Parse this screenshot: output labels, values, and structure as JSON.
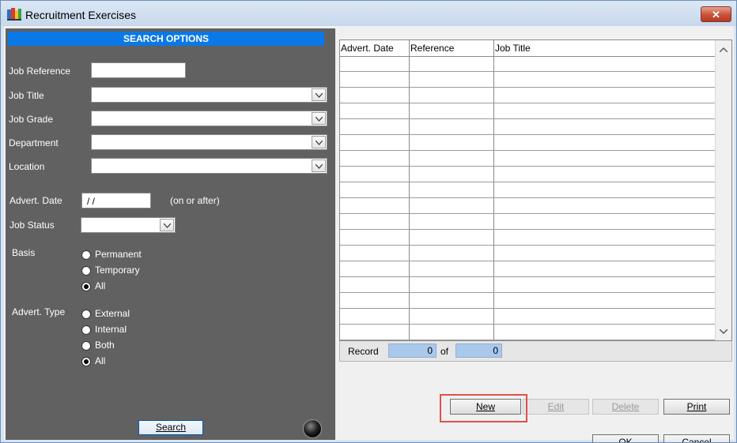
{
  "window": {
    "title": "Recruitment Exercises",
    "close_label": "✕"
  },
  "search": {
    "header": "SEARCH OPTIONS",
    "job_reference_label": "Job Reference",
    "job_reference_value": "",
    "job_title_label": "Job Title",
    "job_title_value": "",
    "job_grade_label": "Job Grade",
    "job_grade_value": "",
    "department_label": "Department",
    "department_value": "",
    "location_label": "Location",
    "location_value": "",
    "advert_date_label": "Advert. Date",
    "advert_date_value": " /  /",
    "advert_date_hint": "(on or after)",
    "job_status_label": "Job Status",
    "job_status_value": "",
    "basis_label": "Basis",
    "basis_options": [
      "Permanent",
      "Temporary",
      "All"
    ],
    "basis_selected": "All",
    "advert_type_label": "Advert. Type",
    "advert_type_options": [
      "External",
      "Internal",
      "Both",
      "All"
    ],
    "advert_type_selected": "All",
    "search_button": "Search"
  },
  "grid": {
    "columns": [
      "Advert. Date",
      "Reference",
      "Job Title"
    ],
    "rows": []
  },
  "record": {
    "label": "Record",
    "current": "0",
    "of_label": "of",
    "total": "0"
  },
  "buttons": {
    "new": "New",
    "edit": "Edit",
    "delete": "Delete",
    "print": "Print",
    "ok": "OK",
    "cancel": "Cancel"
  },
  "colors": {
    "panel_bg": "#616161",
    "header_bg": "#0a78e6",
    "record_box": "#a9c8ec",
    "highlight": "#e0504c"
  }
}
